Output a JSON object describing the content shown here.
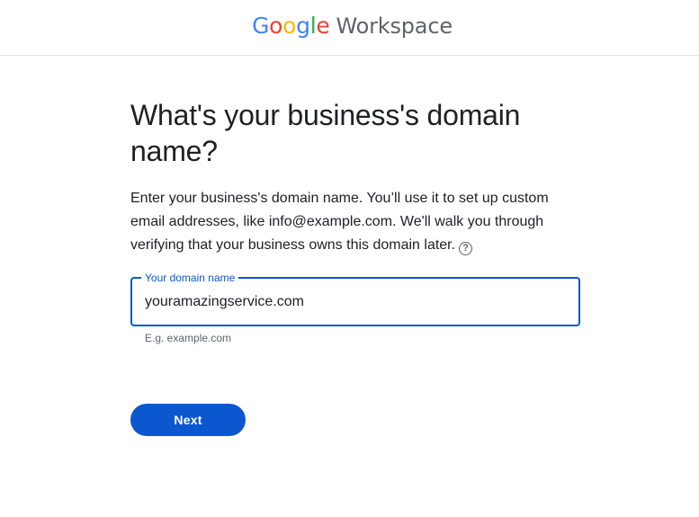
{
  "header": {
    "logo_letters": [
      "G",
      "o",
      "o",
      "g",
      "l",
      "e"
    ],
    "product": "Workspace"
  },
  "main": {
    "title": "What's your business's domain name?",
    "description": "Enter your business's domain name. You’ll use it to set up custom email addresses, like info@example.com. We'll walk you through verifying that your business owns this domain later.",
    "help_icon": "help-circle-icon",
    "help_glyph": "?",
    "domain_field": {
      "label": "Your domain name",
      "value": "youramazingservice.com",
      "hint": "E.g. example.com"
    },
    "next_label": "Next"
  },
  "colors": {
    "accent": "#0b57d0",
    "google_blue": "#4285F4",
    "google_red": "#EA4335",
    "google_yellow": "#FBBC05",
    "google_green": "#34A853",
    "text_secondary": "#5f6368"
  }
}
